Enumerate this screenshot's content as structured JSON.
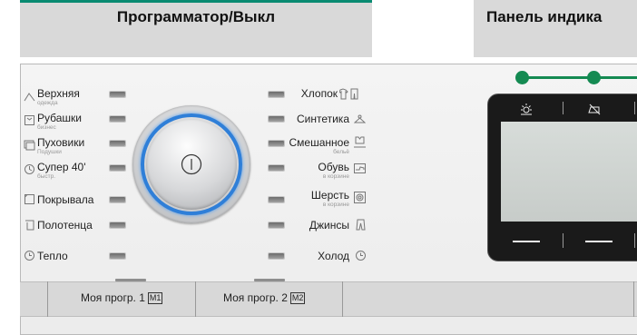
{
  "headers": {
    "left_title": "Программатор/Выкл",
    "right_title": "Панель индика"
  },
  "colors": {
    "accent_green": "#148a52",
    "header_gray": "#d9d9d9",
    "dial_ring_blue": "#2f7fd8"
  },
  "left_programs": [
    {
      "label": "Верхняя",
      "sub": "одежда",
      "icon": "outerwear-icon"
    },
    {
      "label": "Рубашки",
      "sub": "бизнес",
      "icon": "shirt-icon"
    },
    {
      "label": "Пуховики",
      "sub": "Подушки",
      "icon": "pillow-icon"
    },
    {
      "label": "Супер 40'",
      "sub": "быстр.",
      "icon": "quick-wash-icon"
    },
    {
      "label": "Покрывала",
      "sub": "",
      "icon": "blanket-icon"
    },
    {
      "label": "Полотенца",
      "sub": "",
      "icon": "towel-icon"
    },
    {
      "label": "Тепло",
      "sub": "",
      "icon": "clock-icon"
    }
  ],
  "right_programs": [
    {
      "label": "Хлопок",
      "sub": "",
      "icon": "cotton-shirt-icon"
    },
    {
      "label": "Синтетика",
      "sub": "",
      "icon": "synthetics-icon"
    },
    {
      "label": "Смешанное",
      "sub": "бельё",
      "icon": "mixed-laundry-icon"
    },
    {
      "label": "Обувь",
      "sub": "в корзине",
      "icon": "shoes-basket-icon"
    },
    {
      "label": "Шерсть",
      "sub": "в корзине",
      "icon": "wool-basket-icon"
    },
    {
      "label": "Джинсы",
      "sub": "",
      "icon": "jeans-icon"
    },
    {
      "label": "Холод",
      "sub": "",
      "icon": "clock-icon"
    }
  ],
  "memory_buttons": [
    {
      "label": "Моя прогр. 1",
      "key": "M1"
    },
    {
      "label": "Моя прогр. 2",
      "key": "M2"
    }
  ],
  "display": {
    "top_icons": [
      "brightness-icon",
      "no-iron-icon"
    ],
    "bottom_buttons": [
      "—",
      "—"
    ]
  }
}
